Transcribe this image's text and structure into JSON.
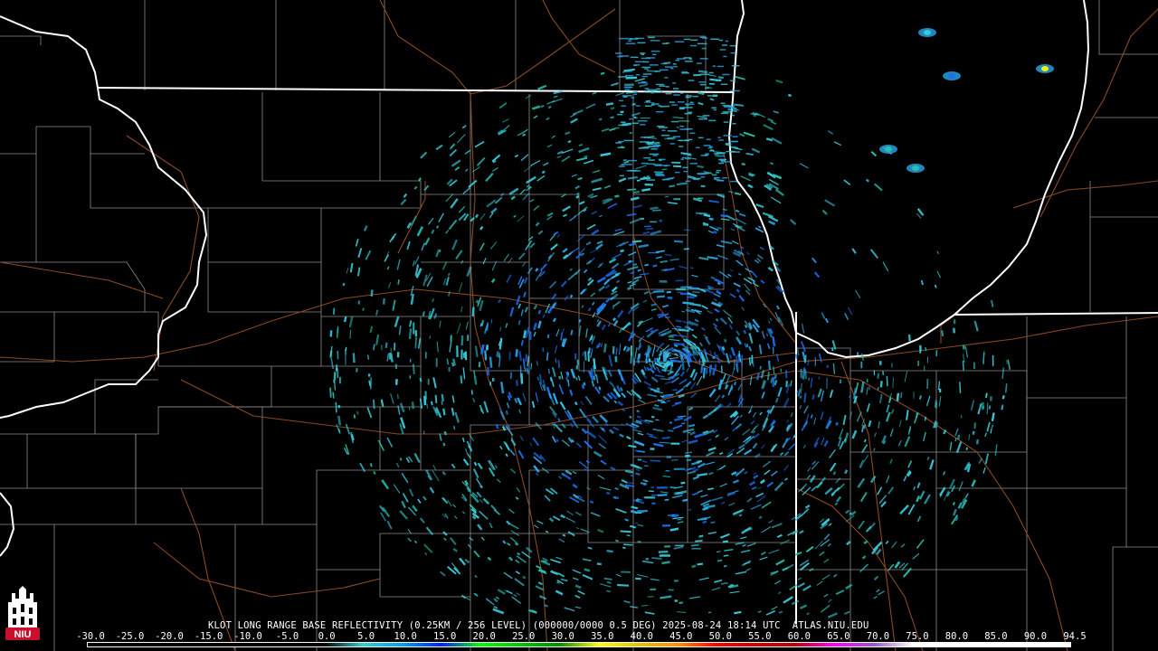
{
  "product": {
    "station": "KLOT",
    "product_name": "LONG RANGE BASE REFLECTIVITY",
    "resolution": "(0.25KM / 256 LEVEL)",
    "code": "(000000/0000 0.5 DEG)",
    "datetime": "2025-08-24 18:14 UTC",
    "source": "ATLAS.NIU.EDU"
  },
  "logo": {
    "text": "NIU",
    "color": "#c8102e"
  },
  "colorbar": {
    "labels": [
      "-30.0",
      "-25.0",
      "-20.0",
      "-15.0",
      "-10.0",
      "-5.0",
      "0.0",
      "5.0",
      "10.0",
      "15.0",
      "20.0",
      "25.0",
      "30.0",
      "35.0",
      "40.0",
      "45.0",
      "50.0",
      "55.0",
      "60.0",
      "65.0",
      "70.0",
      "75.0",
      "80.0",
      "85.0",
      "90.0",
      "94.5"
    ],
    "colors": [
      "#000000",
      "#000000",
      "#000000",
      "#000000",
      "#000000",
      "#000000",
      "#000000",
      "#30d0d0",
      "#00a0f0",
      "#0020ff",
      "#00ff00",
      "#00c800",
      "#009000",
      "#ffff00",
      "#e8c000",
      "#ff9000",
      "#ff0000",
      "#d00000",
      "#c00000",
      "#ff00ff",
      "#9955c9",
      "#ffffff",
      "#ffffff",
      "#ffffff",
      "#ffffff"
    ]
  },
  "map": {
    "background": "#000000",
    "state_border_color": "#ffffff",
    "county_line_color": "#9a9a9a",
    "road_color": "#8a4a20",
    "echo_colors": [
      "#38c8d8",
      "#2aa8e8",
      "#1a6ef0",
      "#25c0b0"
    ],
    "radar_site": "KLOT"
  }
}
